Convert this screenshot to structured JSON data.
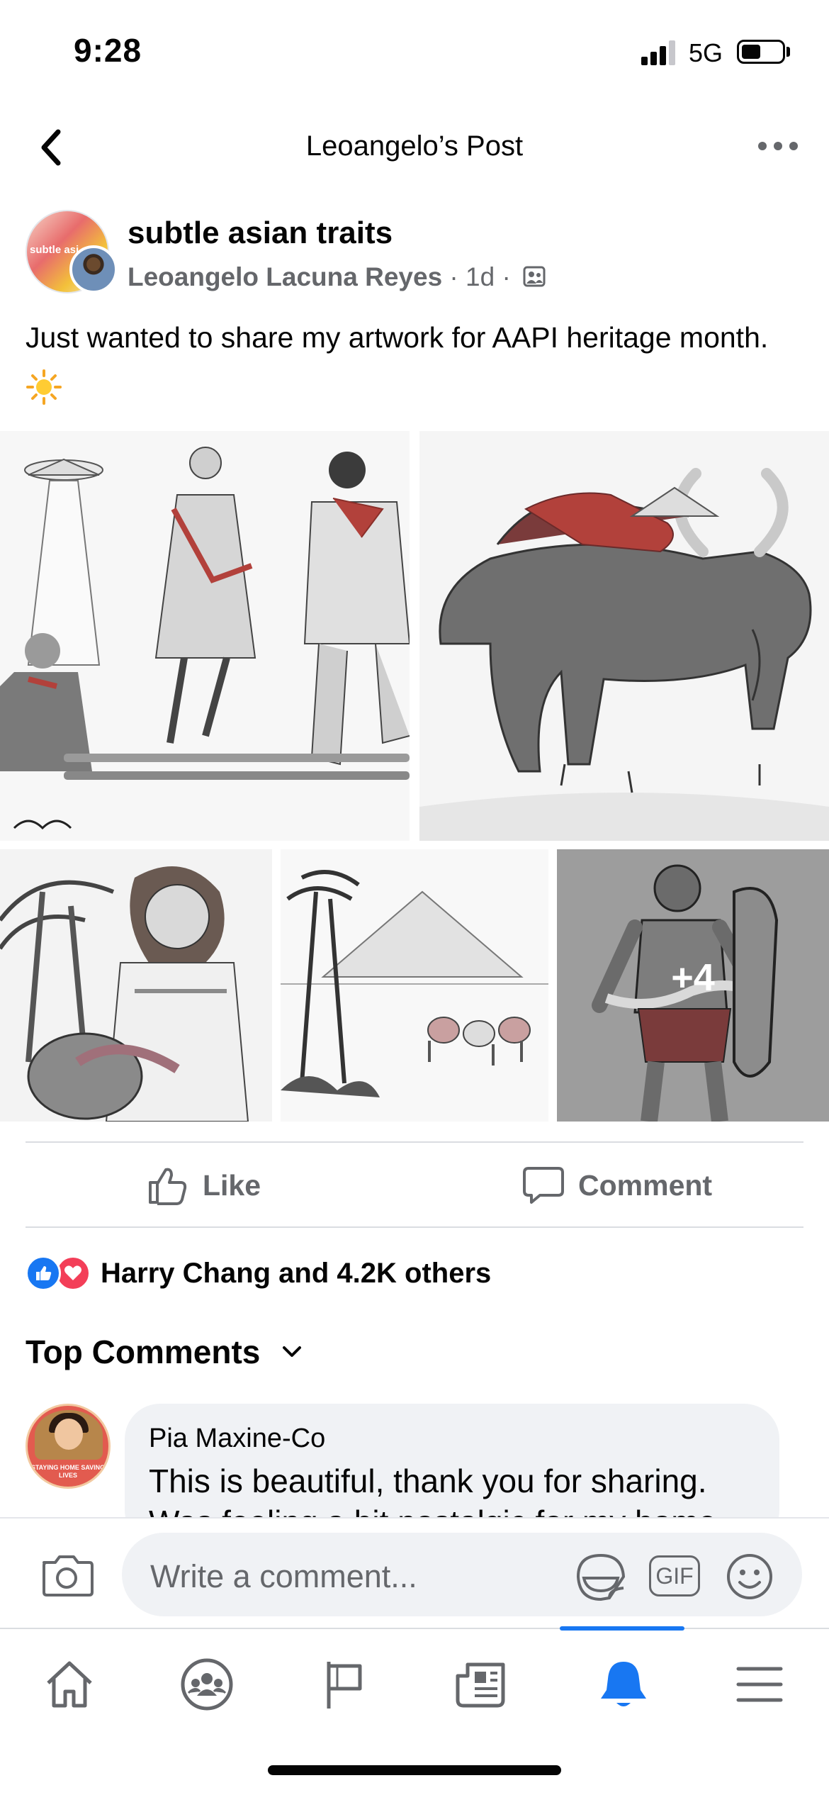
{
  "status_bar": {
    "time": "9:28",
    "network": "5G",
    "signal_bars_active": 3,
    "signal_bars_total": 4,
    "battery_level": 0.4
  },
  "nav": {
    "title": "Leoangelo’s Post",
    "back_icon": "chevron-left-icon",
    "more_icon": "more-horizontal-icon"
  },
  "post": {
    "group_name": "subtle asian traits",
    "group_avatar_text": "subtle asi",
    "author": "Leoangelo Lacuna Reyes",
    "separator": " · ",
    "time": "1d",
    "audience_icon": "group-members-icon",
    "text": "Just wanted to share my artwork for AAPI heritage month.",
    "emoji": "sun-icon",
    "more_photos": "+4"
  },
  "actions": {
    "like_label": "Like",
    "comment_label": "Comment"
  },
  "reactions": {
    "text": "Harry Chang and 4.2K others",
    "types": [
      "like-reaction-icon",
      "love-reaction-icon"
    ]
  },
  "comments_section": {
    "title": "Top Comments"
  },
  "comments": [
    {
      "author": "Pia Maxine-Co",
      "text": "This is beautiful, thank you for sharing. Was feeling a bit nostalgic for my home",
      "avatar_frame_text": "STAYING HOME SAVING LIVES"
    }
  ],
  "composer": {
    "placeholder": "Write a comment...",
    "gif_label": "GIF"
  },
  "tab_bar": {
    "tabs": [
      "home-icon",
      "groups-icon",
      "pages-flag-icon",
      "news-icon",
      "notifications-bell-icon",
      "menu-icon"
    ],
    "active": "notifications-bell-icon"
  },
  "colors": {
    "accent": "#1877f2",
    "secondary_text": "#65676b",
    "bubble": "#f0f2f5",
    "love": "#f33e58"
  }
}
